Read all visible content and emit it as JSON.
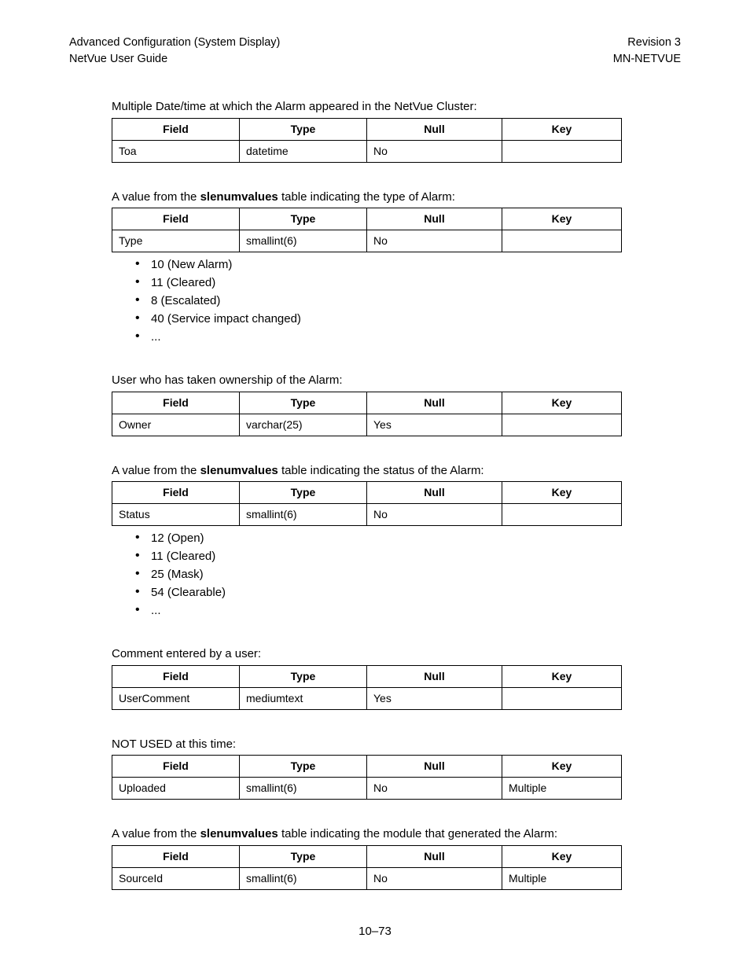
{
  "header": {
    "left_line1": "Advanced Configuration (System Display)",
    "left_line2": "NetVue User Guide",
    "right_line1": "Revision 3",
    "right_line2": "MN-NETVUE"
  },
  "table_headers": {
    "field": "Field",
    "type": "Type",
    "null": "Null",
    "key": "Key"
  },
  "sections": [
    {
      "intro_pre": "Multiple Date/time at which the Alarm appeared in the NetVue Cluster:",
      "intro_bold": "",
      "intro_post": "",
      "row": {
        "field": "Toa",
        "type": "datetime",
        "null": "No",
        "key": ""
      },
      "enum": []
    },
    {
      "intro_pre": "A value from the ",
      "intro_bold": "slenumvalues",
      "intro_post": " table indicating the type of Alarm:",
      "row": {
        "field": "Type",
        "type": "smallint(6)",
        "null": "No",
        "key": ""
      },
      "enum": [
        "10 (New Alarm)",
        "11 (Cleared)",
        "8 (Escalated)",
        "40 (Service impact changed)",
        "..."
      ]
    },
    {
      "intro_pre": "User who has taken ownership of the Alarm:",
      "intro_bold": "",
      "intro_post": "",
      "row": {
        "field": "Owner",
        "type": "varchar(25)",
        "null": "Yes",
        "key": ""
      },
      "enum": []
    },
    {
      "intro_pre": "A value from the ",
      "intro_bold": "slenumvalues",
      "intro_post": " table indicating the status of the Alarm:",
      "row": {
        "field": "Status",
        "type": "smallint(6)",
        "null": "No",
        "key": ""
      },
      "enum": [
        "12 (Open)",
        "11 (Cleared)",
        "25 (Mask)",
        "54 (Clearable)",
        "..."
      ]
    },
    {
      "intro_pre": "Comment entered by a user:",
      "intro_bold": "",
      "intro_post": "",
      "row": {
        "field": "UserComment",
        "type": "mediumtext",
        "null": "Yes",
        "key": ""
      },
      "enum": []
    },
    {
      "intro_pre": "NOT USED at this time:",
      "intro_bold": "",
      "intro_post": "",
      "row": {
        "field": "Uploaded",
        "type": "smallint(6)",
        "null": "No",
        "key": "Multiple"
      },
      "enum": []
    },
    {
      "intro_pre": "A value from the ",
      "intro_bold": "slenumvalues",
      "intro_post": " table indicating the module that generated the Alarm:",
      "row": {
        "field": "SourceId",
        "type": "smallint(6)",
        "null": "No",
        "key": "Multiple"
      },
      "enum": []
    }
  ],
  "footer": "10–73"
}
